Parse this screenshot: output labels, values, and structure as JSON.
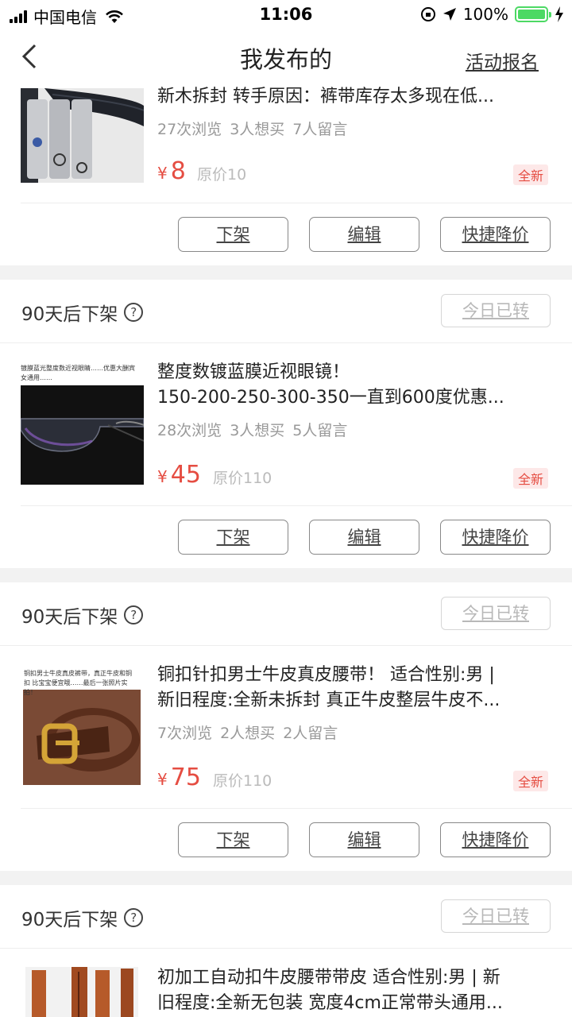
{
  "status_bar": {
    "carrier": "中国电信",
    "time": "11:06",
    "battery": "100%"
  },
  "nav": {
    "title": "我发布的",
    "action": "活动报名"
  },
  "labels": {
    "off_shelf": "下架",
    "edit": "编辑",
    "quick_reduce": "快捷降价",
    "transferred": "今日已转",
    "timer": "90天后下架",
    "help": "?",
    "new_tag": "全新",
    "yen": "¥"
  },
  "items": [
    {
      "title": [
        "新木拆封 转手原因：裤带库存太多现在低..."
      ],
      "views": "27次浏览",
      "wants": "3人想买",
      "comments": "7人留言",
      "price": "8",
      "original": "原价10"
    },
    {
      "title": [
        "整度数镀蓝膜近视眼镜！",
        "150-200-250-300-350一直到600度优惠..."
      ],
      "views": "28次浏览",
      "wants": "3人想买",
      "comments": "5人留言",
      "price": "45",
      "original": "原价110",
      "thumb_caption": "镀膜蓝光整度数近视眼睛……优惠大酬宾 女通用……"
    },
    {
      "title": [
        "铜扣针扣男士牛皮真皮腰带！ 适合性别:男 |",
        "新旧程度:全新未拆封 真正牛皮整层牛皮不..."
      ],
      "views": "7次浏览",
      "wants": "2人想买",
      "comments": "2人留言",
      "price": "75",
      "original": "原价110",
      "thumb_caption": "铜扣男士牛皮真皮裤带，真正牛皮和铜扣 比宝宝便宜哦……最后一张照片实拍！"
    },
    {
      "title": [
        "初加工自动扣牛皮腰带带皮 适合性别:男 | 新",
        "旧程度:全新无包装 宽度4cm正常带头通用..."
      ]
    }
  ],
  "colors": {
    "accent": "#e54d42",
    "battery": "#4cd964"
  }
}
